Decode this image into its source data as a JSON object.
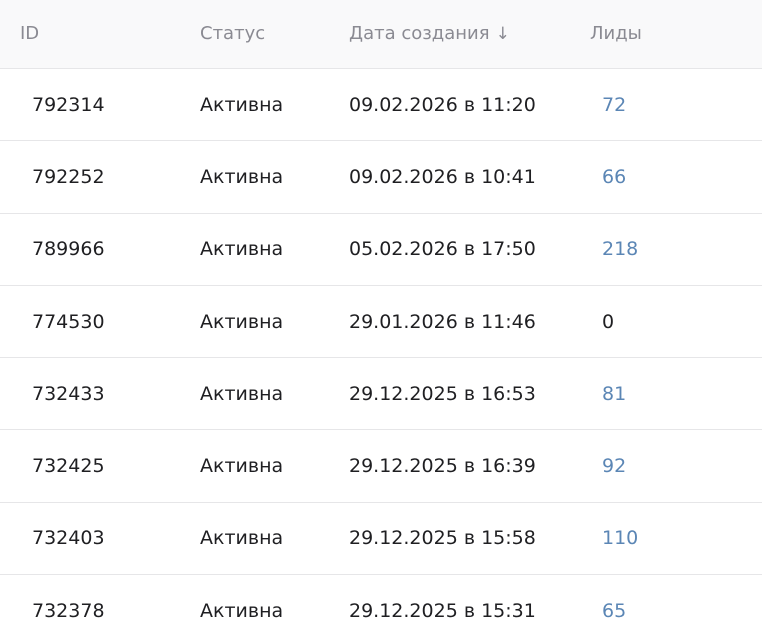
{
  "table": {
    "headers": {
      "id": "ID",
      "status": "Статус",
      "date": "Дата создания",
      "leads": "Лиды",
      "sort_glyph": "↓"
    },
    "rows": [
      {
        "id": "792314",
        "status": "Активна",
        "date": "09.02.2026 в 11:20",
        "leads": "72"
      },
      {
        "id": "792252",
        "status": "Активна",
        "date": "09.02.2026 в 10:41",
        "leads": "66"
      },
      {
        "id": "789966",
        "status": "Активна",
        "date": "05.02.2026 в 17:50",
        "leads": "218"
      },
      {
        "id": "774530",
        "status": "Активна",
        "date": "29.01.2026 в 11:46",
        "leads": "0"
      },
      {
        "id": "732433",
        "status": "Активна",
        "date": "29.12.2025 в 16:53",
        "leads": "81"
      },
      {
        "id": "732425",
        "status": "Активна",
        "date": "29.12.2025 в 16:39",
        "leads": "92"
      },
      {
        "id": "732403",
        "status": "Активна",
        "date": "29.12.2025 в 15:58",
        "leads": "110"
      },
      {
        "id": "732378",
        "status": "Активна",
        "date": "29.12.2025 в 15:31",
        "leads": "65"
      }
    ]
  },
  "colors": {
    "link": "#5b86b5",
    "header_text": "#8a8a92",
    "text": "#1f1f22",
    "header_bg": "#f9f9fa",
    "divider": "#e6e6e8"
  }
}
